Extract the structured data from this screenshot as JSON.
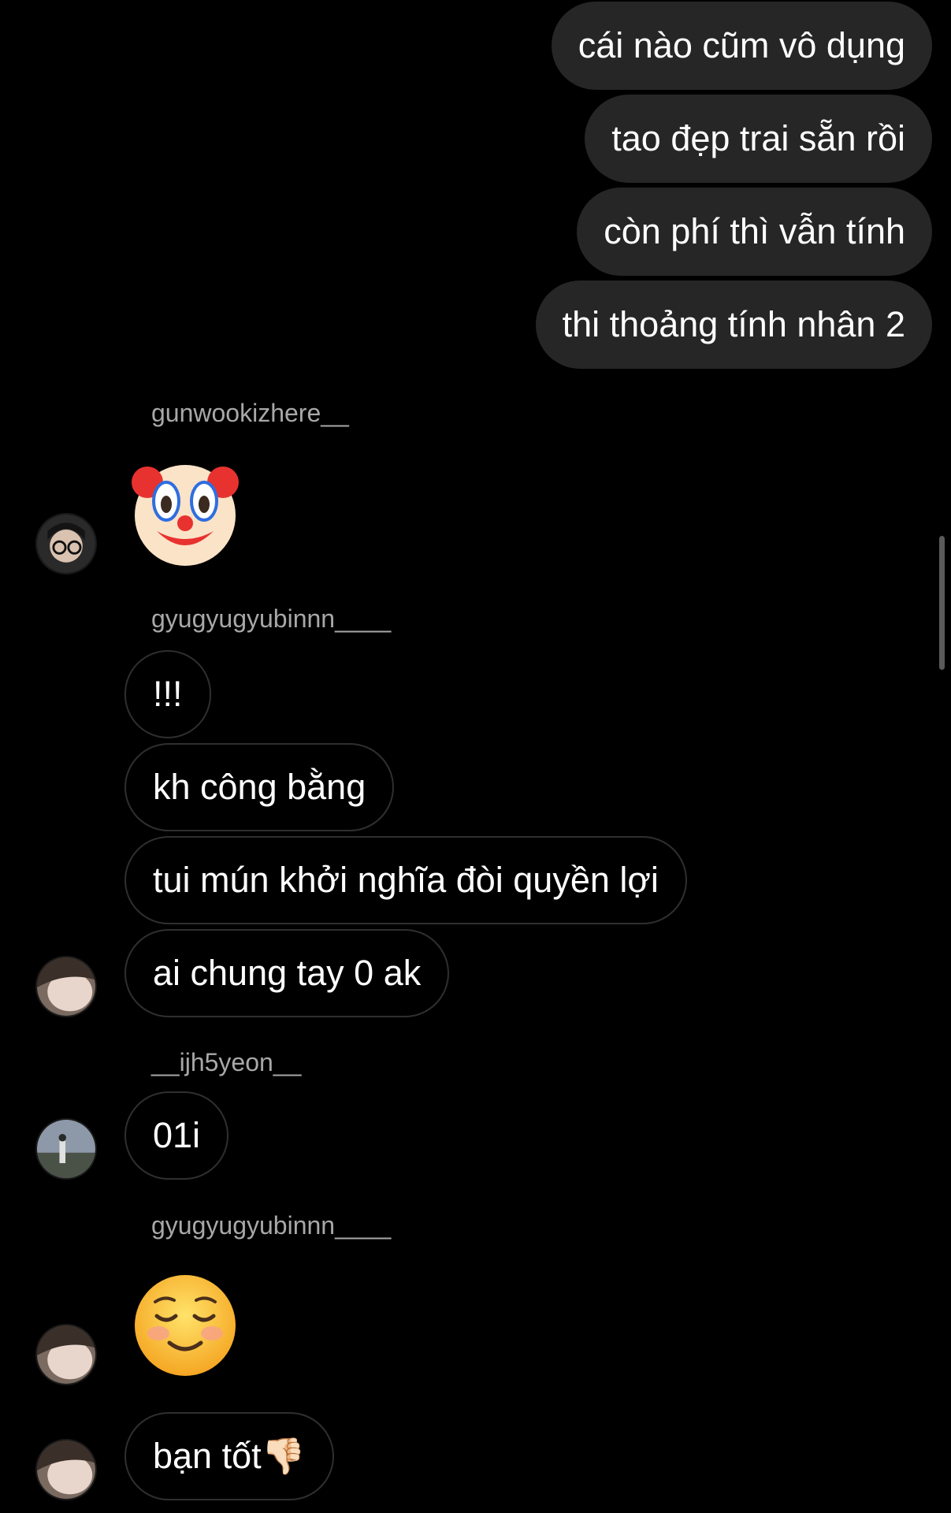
{
  "outgoing": [
    {
      "text": "cái nào cũm vô dụng"
    },
    {
      "text": "tao đẹp trai sẵn rồi"
    },
    {
      "text": "còn phí thì vẫn tính"
    },
    {
      "text": "thi thoảng tính nhân 2"
    }
  ],
  "groups": [
    {
      "sender": "gunwookizhere__",
      "emoji": "clown-face"
    },
    {
      "sender": "gyugyugyubinnn____",
      "messages": [
        "!!!",
        "kh công bằng",
        "tui mún khởi nghĩa đòi quyền lợi",
        "ai chung tay 0 ak"
      ]
    },
    {
      "sender": "__ijh5yeon__",
      "messages": [
        "01i"
      ]
    },
    {
      "sender": "gyugyugyubinnn____",
      "emoji": "smiling-face",
      "messages": [
        "bạn tốt👎🏻"
      ]
    }
  ],
  "colors": {
    "background": "#000000",
    "outgoing_bubble": "#262626",
    "incoming_border": "#2f2f2f",
    "sender_text": "#a8a8a8"
  }
}
